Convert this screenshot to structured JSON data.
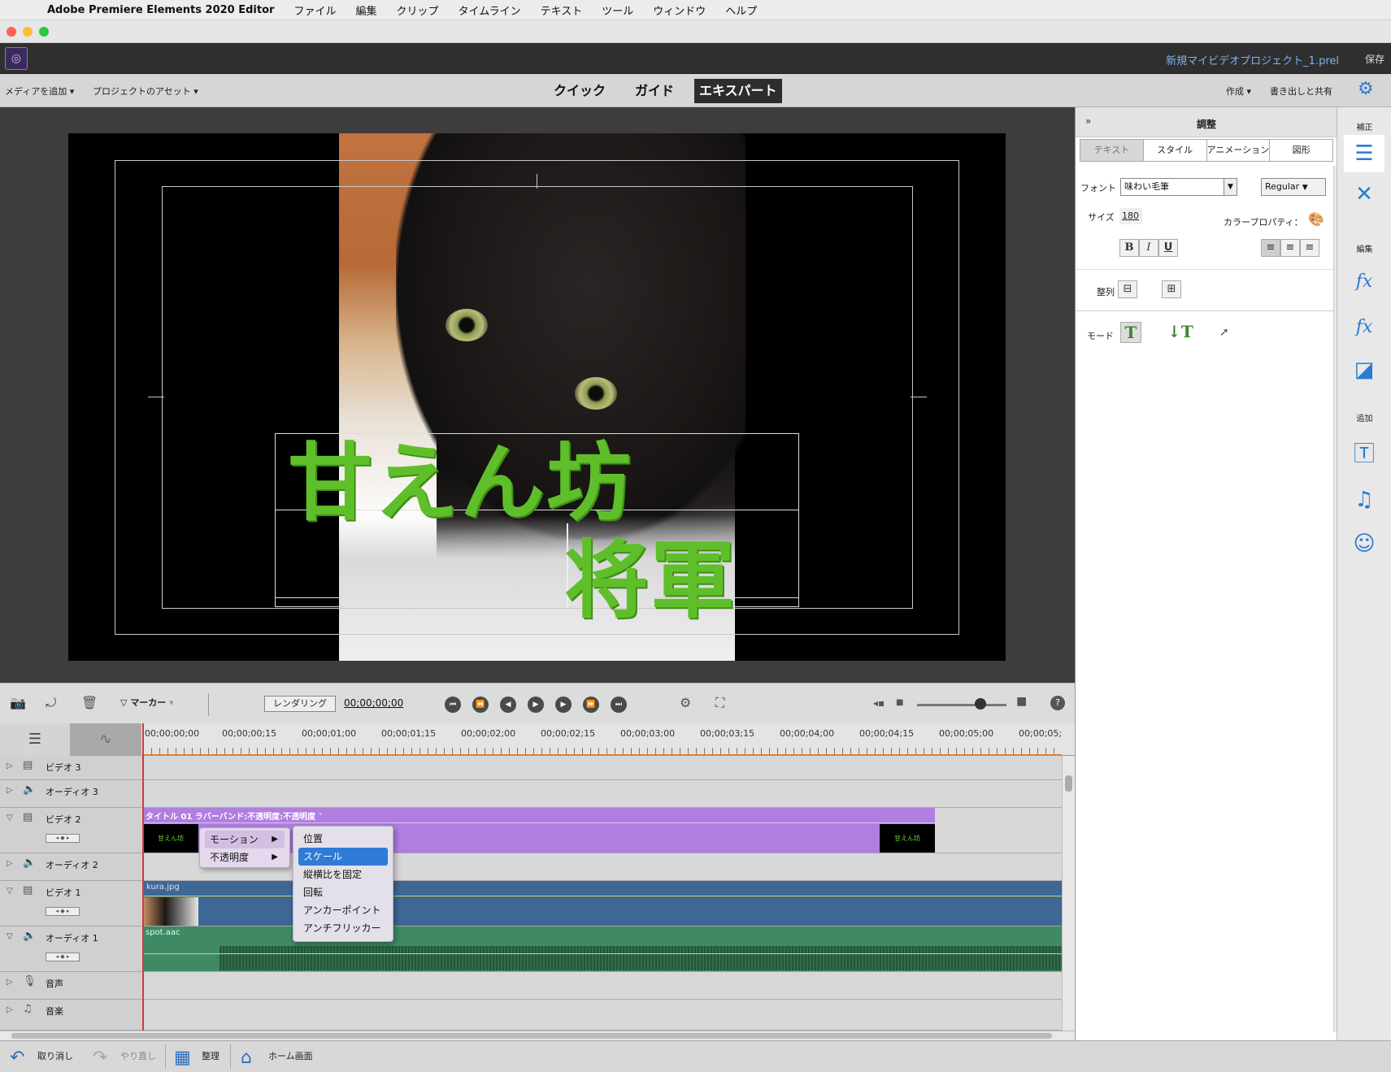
{
  "menubar": {
    "app_name": "Adobe Premiere Elements 2020 Editor",
    "items": [
      "ファイル",
      "編集",
      "クリップ",
      "タイムライン",
      "テキスト",
      "ツール",
      "ウィンドウ",
      "ヘルプ"
    ]
  },
  "appbar": {
    "project_name": "新規マイビデオプロジェクト_1.prel",
    "save_label": "保存"
  },
  "modebar": {
    "add_media": "メディアを追加",
    "project_assets": "プロジェクトのアセット",
    "tabs": [
      "クイック",
      "ガイド",
      "エキスパート"
    ],
    "active_tab": "エキスパート",
    "create": "作成",
    "export_share": "書き出しと共有"
  },
  "monitor": {
    "title_line1": "甘えん坊",
    "title_line2": "将軍"
  },
  "transport": {
    "marker_label": "マーカー",
    "render_label": "レンダリング",
    "timecode": "00;00;00;00"
  },
  "ruler": {
    "labels": [
      "00;00;00;00",
      "00;00;00;15",
      "00;00;01;00",
      "00;00;01;15",
      "00;00;02;00",
      "00;00;02;15",
      "00;00;03;00",
      "00;00;03;15",
      "00;00;04;00",
      "00;00;04;15",
      "00;00;05;00",
      "00;00;05;"
    ]
  },
  "tracks": [
    {
      "name": "ビデオ 3"
    },
    {
      "name": "オーディオ 3"
    },
    {
      "name": "ビデオ 2",
      "clip": "タイトル 01 ラバーバンド:不透明度:不透明度 ˅"
    },
    {
      "name": "オーディオ 2"
    },
    {
      "name": "ビデオ 1",
      "clip": "kura.jpg"
    },
    {
      "name": "オーディオ 1",
      "clip": "spot.aac"
    },
    {
      "name": "音声"
    },
    {
      "name": "音楽"
    }
  ],
  "context_menu": {
    "level1": [
      "モーション",
      "不透明度"
    ],
    "level2": [
      "位置",
      "スケール",
      "縦横比を固定",
      "回転",
      "アンカーポイント",
      "アンチフリッカー"
    ],
    "selected": "スケール"
  },
  "panel": {
    "title": "調整",
    "tabs": [
      "テキスト",
      "スタイル",
      "アニメーション",
      "図形"
    ],
    "active_tab": "テキスト",
    "font_label": "フォント",
    "font_value": "味わい毛筆",
    "font_style": "Regular",
    "size_label": "サイズ",
    "size_value": "180",
    "color_label": "カラープロパティ：",
    "align_label": "整列",
    "mode_label": "モード"
  },
  "rightbar": {
    "adjust_label": "補正",
    "edit_label": "編集",
    "add_label": "追加"
  },
  "bottombar": {
    "undo": "取り消し",
    "redo": "やり直し",
    "organize": "整理",
    "home": "ホーム画面"
  },
  "colors": {
    "accent": "#2f7bd6",
    "title_text": "#5fbf2a",
    "title_clip": "#b07ee0",
    "video_clip": "#3e6796",
    "audio_clip": "#3f8a64"
  }
}
